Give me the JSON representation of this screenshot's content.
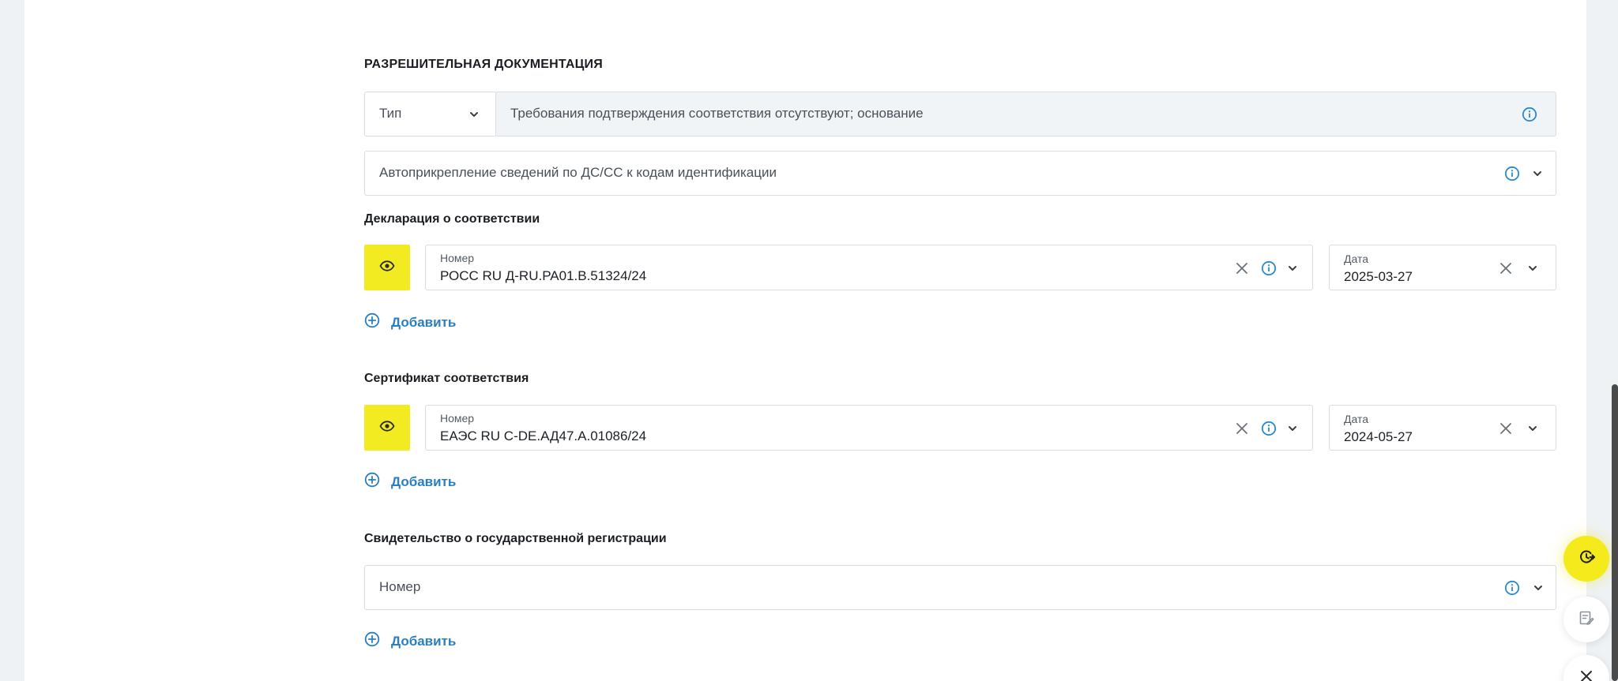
{
  "section": {
    "title": "РАЗРЕШИТЕЛЬНАЯ ДОКУМЕНТАЦИЯ"
  },
  "type_select": {
    "label": "Тип",
    "value": "Требования подтверждения соответствия отсутствуют; основание"
  },
  "auto_attach": {
    "label": "Автоприкрепление сведений по ДС/СС к кодам идентификации"
  },
  "declaration": {
    "title": "Декларация о соответствии",
    "number_label": "Номер",
    "number_value": "РОСС RU Д-RU.PA01.B.51324/24",
    "date_label": "Дата",
    "date_value": "2025-03-27",
    "add_label": "Добавить"
  },
  "certificate": {
    "title": "Сертификат соответствия",
    "number_label": "Номер",
    "number_value": "ЕАЭС RU C-DE.АД47.А.01086/24",
    "date_label": "Дата",
    "date_value": "2024-05-27",
    "add_label": "Добавить"
  },
  "registration": {
    "title": "Свидетельство о государственной регистрации",
    "number_placeholder": "Номер",
    "add_label": "Добавить"
  },
  "icons": {
    "info": "info-icon",
    "chevron": "chevron-down-icon",
    "clear": "close-icon",
    "eye": "eye-icon",
    "add": "plus-circle-icon"
  },
  "colors": {
    "accent_yellow": "#f2eb21",
    "link_blue": "#2a7fc4",
    "info_blue": "#2a8ad0"
  }
}
